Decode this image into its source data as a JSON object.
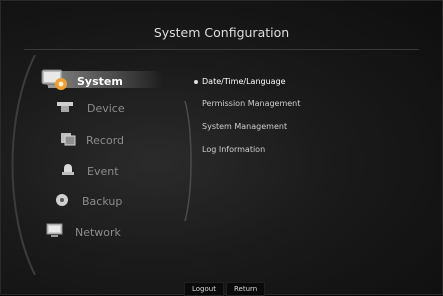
{
  "window": {
    "title": "System Configuration"
  },
  "menu": {
    "items": [
      {
        "label": "System",
        "icon": "system-monitor-gear-icon",
        "active": true
      },
      {
        "label": "Device",
        "icon": "device-camera-icon"
      },
      {
        "label": "Record",
        "icon": "record-film-icon"
      },
      {
        "label": "Event",
        "icon": "event-alarm-icon"
      },
      {
        "label": "Backup",
        "icon": "backup-disc-icon"
      },
      {
        "label": "Network",
        "icon": "network-monitor-icon"
      }
    ]
  },
  "submenu": {
    "items": [
      {
        "label": "Date/Time/Language",
        "selected": true
      },
      {
        "label": "Permission Management"
      },
      {
        "label": "System Management"
      },
      {
        "label": "Log Information"
      }
    ]
  },
  "footer": {
    "logout_label": "Logout",
    "return_label": "Return"
  },
  "colors": {
    "background": "#1a1a1a",
    "active_text": "#ffffff",
    "inactive_text": "#8c8c8c"
  }
}
